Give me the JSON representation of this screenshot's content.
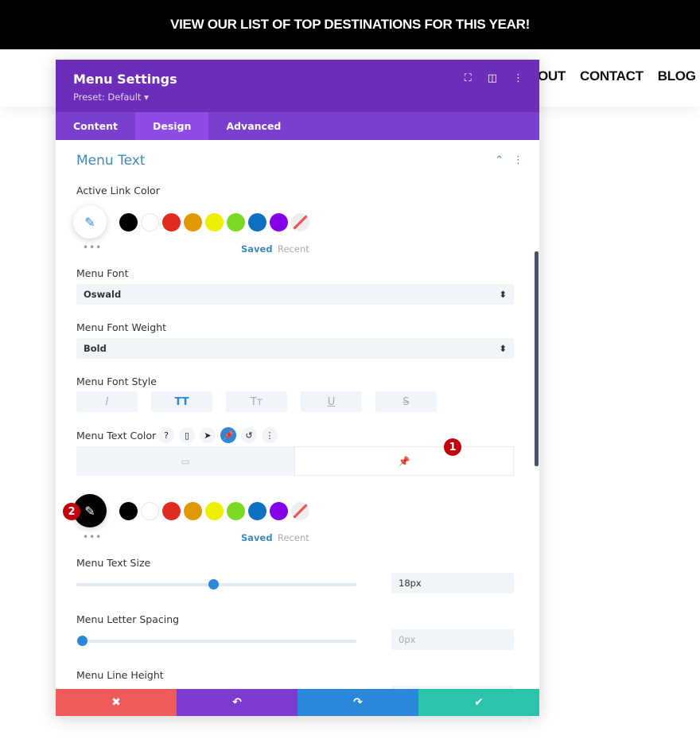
{
  "banner": "VIEW OUR LIST OF TOP DESTINATIONS FOR THIS YEAR!",
  "nav": [
    "OUT",
    "CONTACT",
    "BLOG"
  ],
  "panel": {
    "title": "Menu Settings",
    "preset": "Preset: Default ▾",
    "tabs": [
      "Content",
      "Design",
      "Advanced"
    ],
    "active_tab": "Design",
    "section": "Menu Text",
    "active_link_color": {
      "label": "Active Link Color",
      "saved": "Saved",
      "recent": "Recent"
    },
    "swatch_colors": [
      "#000000",
      "#ffffff",
      "#e02b20",
      "#e09900",
      "#edf000",
      "#7cda24",
      "#0c71c3",
      "#8300e9"
    ],
    "menu_font": {
      "label": "Menu Font",
      "value": "Oswald"
    },
    "menu_font_weight": {
      "label": "Menu Font Weight",
      "value": "Bold"
    },
    "menu_font_style": {
      "label": "Menu Font Style",
      "buttons": [
        "I",
        "TT",
        "Tт",
        "U",
        "S"
      ]
    },
    "menu_text_color": {
      "label": "Menu Text Color",
      "saved": "Saved",
      "recent": "Recent",
      "picked": "#000000"
    },
    "menu_text_size": {
      "label": "Menu Text Size",
      "value": "18px",
      "percent": 49
    },
    "menu_letter_spacing": {
      "label": "Menu Letter Spacing",
      "value": "0px",
      "percent": 2
    },
    "menu_line_height": {
      "label": "Menu Line Height"
    },
    "badges": [
      "1",
      "2"
    ],
    "footer_colors": [
      "#ef5a5a",
      "#7e3bd0",
      "#2b87da",
      "#29c4a9"
    ]
  }
}
